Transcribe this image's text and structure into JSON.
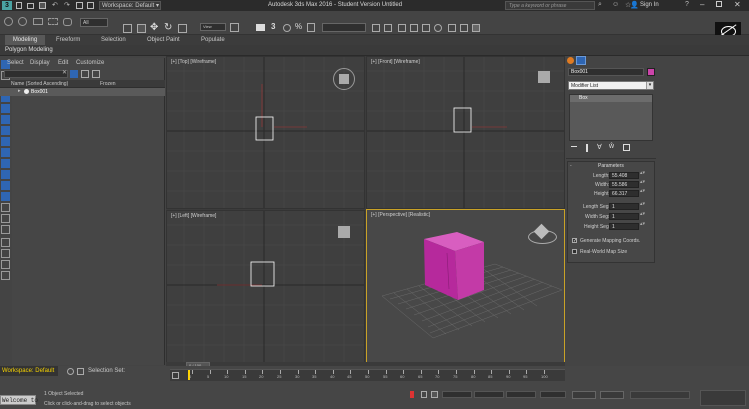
{
  "title_bar": {
    "workspace_label": "Workspace: Default",
    "app_title": "Autodesk 3ds Max 2016 - Student Version   Untitled",
    "search_placeholder": "Type a keyword or phrase",
    "sign_in": "Sign In"
  },
  "ribbon_tabs": [
    "Modeling",
    "Freeform",
    "Selection",
    "Object Paint",
    "Populate"
  ],
  "ribbon_subtitle": "Polygon Modeling",
  "main_toolbar": {
    "selection_filter": "All",
    "snap_label": "3"
  },
  "scene_explorer": {
    "menu": [
      "Select",
      "Display",
      "Edit",
      "Customize"
    ],
    "columns": {
      "name": "Name (Sorted Ascending)",
      "frozen": "Frozen"
    },
    "items": [
      {
        "name": "Box001"
      }
    ]
  },
  "viewports": {
    "top": "[+] [Top] [Wireframe]",
    "front": "[+] [Front] [Wireframe]",
    "left": "[+] [Left] [Wireframe]",
    "perspective": "[+] [Perspective] [Realistic]"
  },
  "command_panel": {
    "object_name": "Box001",
    "object_color": "#cc44aa",
    "modifier_list": "Modifier List",
    "stack_item": "Box",
    "rollout_title": "Parameters",
    "length_label": "Length:",
    "length_value": "55.408",
    "width_label": "Width:",
    "width_value": "55.586",
    "height_label": "Height:",
    "height_value": "66.317",
    "length_segs_label": "Length Segs:",
    "length_segs_value": "1",
    "width_segs_label": "Width Segs:",
    "width_segs_value": "1",
    "height_segs_label": "Height Segs:",
    "height_segs_value": "1",
    "gen_mapping_label": "Generate Mapping Coords.",
    "gen_mapping_checked": true,
    "real_world_label": "Real-World Map Size",
    "real_world_checked": false
  },
  "time_slider": {
    "frame_label": "0 / 100",
    "ticks": [
      "0",
      "5",
      "10",
      "15",
      "20",
      "25",
      "30",
      "35",
      "40",
      "45",
      "50",
      "55",
      "60",
      "65",
      "70",
      "75",
      "80",
      "85",
      "90",
      "95",
      "100"
    ]
  },
  "bottom": {
    "workspace": "Workspace: Default",
    "selection_set_label": "Selection Set:",
    "welcome": "Welcome to",
    "status_text": "1 Object Selected",
    "prompt_text": "Click or click-and-drag to select objects"
  },
  "colors": {
    "accent_blue": "#2f66b3",
    "box_magenta": "#c0309a",
    "selection_yellow": "#ffd400"
  }
}
